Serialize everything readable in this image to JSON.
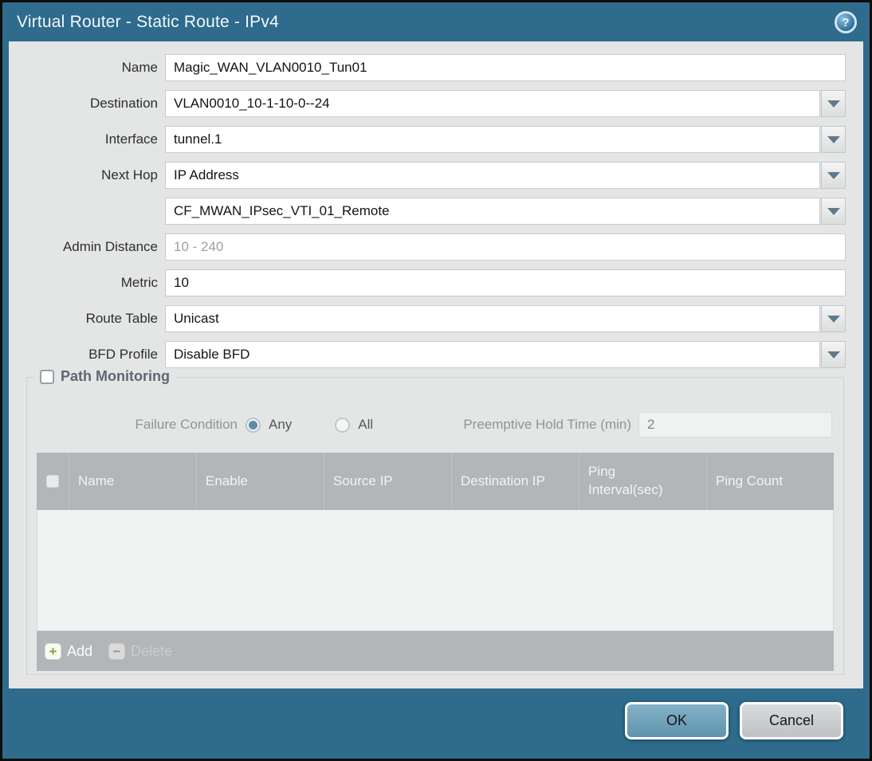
{
  "dialog": {
    "title": "Virtual Router - Static Route - IPv4"
  },
  "icons": {
    "help": "help-question-icon",
    "dropdown": "chevron-down-icon",
    "add": "plus-icon",
    "delete": "minus-icon"
  },
  "colors": {
    "titlebar_teal": "#2e6b8c",
    "panel_background": "#e4e5e5",
    "table_header_gray": "#b2b6b9",
    "ok_button": "#6da1ba",
    "radio_selected": "#5e8ca6",
    "add_icon_green": "#84a23a",
    "delete_icon_red": "#ad6a58"
  },
  "form": {
    "name": {
      "label": "Name",
      "value": "Magic_WAN_VLAN0010_Tun01"
    },
    "destination": {
      "label": "Destination",
      "value": "VLAN0010_10-1-10-0--24"
    },
    "interface": {
      "label": "Interface",
      "value": "tunnel.1"
    },
    "next_hop": {
      "label": "Next Hop",
      "value": "IP Address"
    },
    "next_hop_address": {
      "value": "CF_MWAN_IPsec_VTI_01_Remote"
    },
    "admin_distance": {
      "label": "Admin Distance",
      "placeholder": "10 - 240"
    },
    "metric": {
      "label": "Metric",
      "value": "10"
    },
    "route_table": {
      "label": "Route Table",
      "value": "Unicast"
    },
    "bfd_profile": {
      "label": "BFD Profile",
      "value": "Disable BFD"
    }
  },
  "path_monitoring": {
    "title": "Path Monitoring",
    "enabled": false,
    "failure_condition_label": "Failure Condition",
    "options": [
      {
        "label": "Any",
        "selected": true
      },
      {
        "label": "All",
        "selected": false
      }
    ],
    "preemptive_label": "Preemptive Hold Time (min)",
    "preemptive_value": "2",
    "table": {
      "columns": [
        "Name",
        "Enable",
        "Source IP",
        "Destination IP",
        "Ping Interval(sec)",
        "Ping Count"
      ],
      "rows": []
    },
    "add_label": "Add",
    "delete_label": "Delete"
  },
  "footer": {
    "ok_label": "OK",
    "cancel_label": "Cancel"
  }
}
